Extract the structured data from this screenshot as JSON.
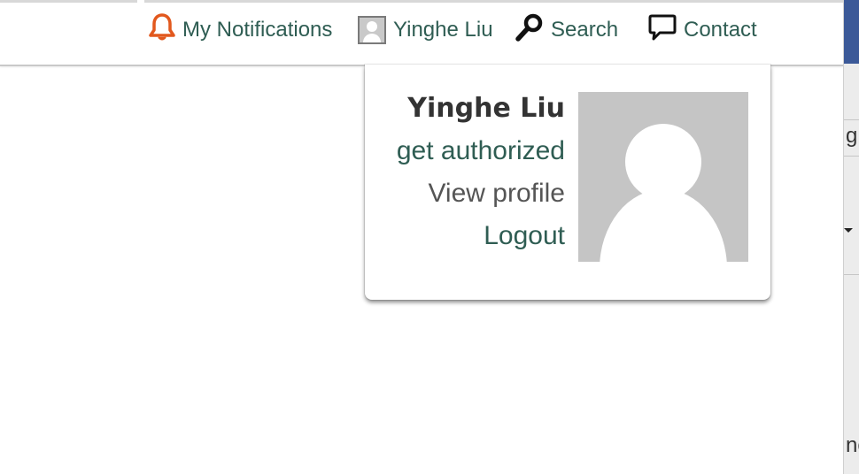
{
  "header": {
    "notifications_label": "My Notifications",
    "user_label": "Yinghe Liu",
    "search_label": "Search",
    "contact_label": "Contact"
  },
  "user_menu": {
    "name": "Yinghe Liu",
    "get_authorized_label": "get authorized",
    "view_profile_label": "View profile",
    "logout_label": "Logout"
  },
  "right_edge": {
    "partial_text_1": "g",
    "partial_text_2": "nc"
  },
  "colors": {
    "link_green": "#2f5d53",
    "bell_orange": "#e2581d",
    "avatar_gray": "#c5c5c5"
  },
  "icons": {
    "notifications": "bell-icon",
    "user": "user-avatar-icon",
    "search": "magnifier-icon",
    "contact": "speech-bubble-icon"
  }
}
